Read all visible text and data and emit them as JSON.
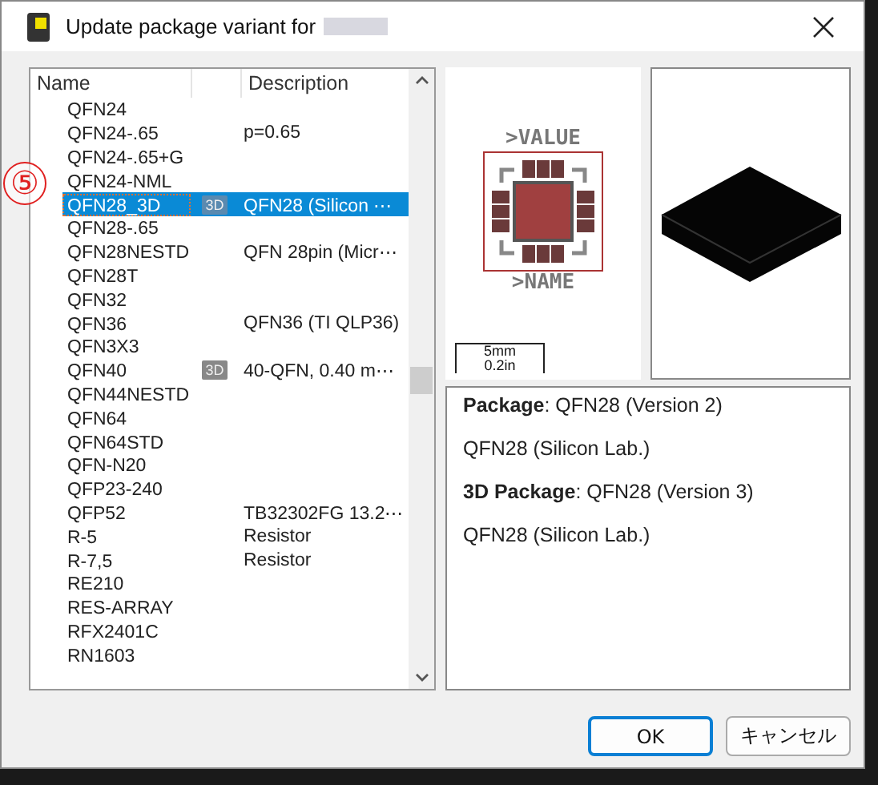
{
  "window": {
    "title": "Update package variant for"
  },
  "callout": "⑤",
  "table": {
    "columns": [
      "Name",
      "Description"
    ],
    "rows": [
      {
        "name": "QFN24",
        "selected": false
      },
      {
        "name": "QFN24-.65",
        "description": "p=0.65",
        "selected": false
      },
      {
        "name": "QFN24-.65+G",
        "selected": false
      },
      {
        "name": "QFN24-NML",
        "selected": false
      },
      {
        "name": "QFN28_3D",
        "badge": "3D",
        "description": "QFN28 (Silicon ⋯",
        "selected": true
      },
      {
        "name": "QFN28-.65",
        "selected": false
      },
      {
        "name": "QFN28NESTD",
        "description": "QFN 28pin (Micr⋯",
        "selected": false
      },
      {
        "name": "QFN28T",
        "selected": false
      },
      {
        "name": "QFN32",
        "selected": false
      },
      {
        "name": "QFN36",
        "description": "QFN36 (TI QLP36)",
        "selected": false
      },
      {
        "name": "QFN3X3",
        "selected": false
      },
      {
        "name": "QFN40",
        "badge": "3D",
        "description": "40-QFN, 0.40 m⋯",
        "selected": false
      },
      {
        "name": "QFN44NESTD",
        "selected": false
      },
      {
        "name": "QFN64",
        "selected": false
      },
      {
        "name": "QFN64STD",
        "selected": false
      },
      {
        "name": "QFN-N20",
        "selected": false
      },
      {
        "name": "QFP23-240",
        "selected": false
      },
      {
        "name": "QFP52",
        "description": "TB32302FG 13.2⋯",
        "selected": false
      },
      {
        "name": "R-5",
        "description": "Resistor",
        "selected": false
      },
      {
        "name": "R-7,5",
        "description": "Resistor",
        "selected": false
      },
      {
        "name": "RE210",
        "selected": false
      },
      {
        "name": "RES-ARRAY",
        "selected": false
      },
      {
        "name": "RFX2401C",
        "selected": false
      },
      {
        "name": "RN1603",
        "selected": false
      }
    ]
  },
  "preview": {
    "value_label": ">VALUE",
    "name_label": ">NAME",
    "scale_mm": "5mm",
    "scale_in": "0.2in"
  },
  "info": [
    "**Package**: QFN28 (Version 2)",
    "QFN28 (Silicon Lab.)",
    "**3D Package**: QFN28 (Version 3)",
    "QFN28 (Silicon Lab.)"
  ],
  "buttons": [
    "OK",
    "キャンセル"
  ]
}
